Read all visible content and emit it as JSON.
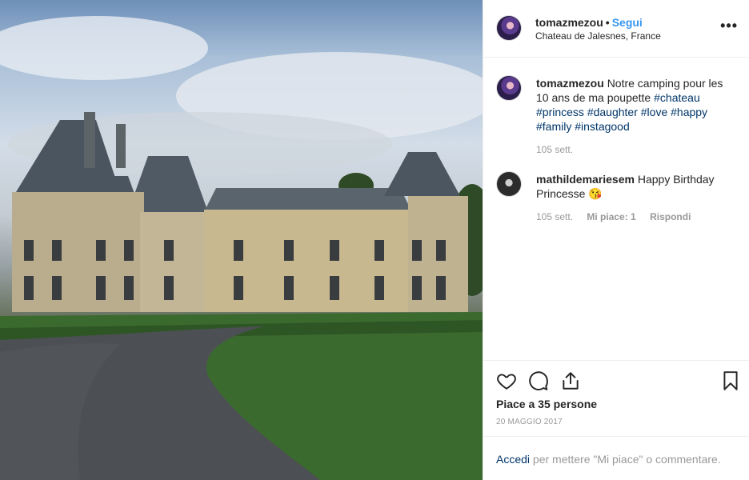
{
  "post": {
    "username": "tomazmezou",
    "follow_label": "Segui",
    "separator": "•",
    "location": "Chateau de Jalesnes, France",
    "more_label": "•••"
  },
  "caption": {
    "username": "tomazmezou",
    "text": "Notre camping pour les 10 ans de ma poupette",
    "hashtags": [
      "#chateau",
      "#princess",
      "#daughter",
      "#love",
      "#happy",
      "#family",
      "#instagood"
    ],
    "time": "105 sett."
  },
  "comment": {
    "username": "mathildemariesem",
    "text": "Happy Birthday Princesse",
    "emoji": "😘",
    "time": "105 sett.",
    "likes": "Mi piace: 1",
    "reply": "Rispondi"
  },
  "actions": {
    "like_icon": "heart-icon",
    "comment_icon": "comment-icon",
    "share_icon": "share-icon",
    "save_icon": "bookmark-icon",
    "likes_text": "Piace a 35 persone",
    "date": "20 MAGGIO 2017"
  },
  "login": {
    "link": "Accedi",
    "rest": " per mettere \"Mi piace\" o commentare."
  },
  "colors": {
    "link_blue": "#3897f0",
    "hashtag_blue": "#003569",
    "muted": "#999999"
  }
}
